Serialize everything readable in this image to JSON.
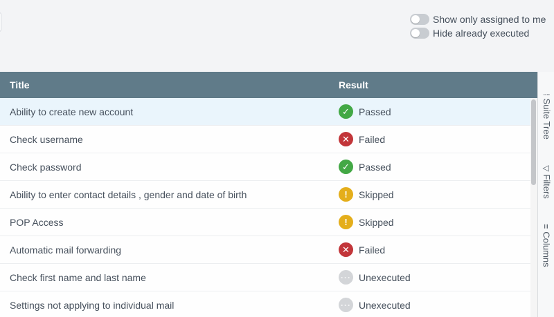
{
  "toggles": [
    {
      "label": "Show only assigned to me",
      "on": false
    },
    {
      "label": "Hide already executed",
      "on": false
    }
  ],
  "grid": {
    "columns": {
      "title": "Title",
      "result": "Result"
    },
    "rows": [
      {
        "title": "Ability to create new account",
        "result": "Passed",
        "status": "passed",
        "icon": "✓"
      },
      {
        "title": "Check username",
        "result": "Failed",
        "status": "failed",
        "icon": "✕"
      },
      {
        "title": "Check password",
        "result": "Passed",
        "status": "passed",
        "icon": "✓"
      },
      {
        "title": "Ability to enter contact details , gender and date of birth",
        "result": "Skipped",
        "status": "skipped",
        "icon": "!"
      },
      {
        "title": "POP Access",
        "result": "Skipped",
        "status": "skipped",
        "icon": "!"
      },
      {
        "title": "Automatic mail forwarding",
        "result": "Failed",
        "status": "failed",
        "icon": "✕"
      },
      {
        "title": "Check first name and last name",
        "result": "Unexecuted",
        "status": "unexecuted",
        "icon": "···"
      },
      {
        "title": "Settings not applying to individual mail",
        "result": "Unexecuted",
        "status": "unexecuted",
        "icon": "···"
      }
    ]
  },
  "side_panel": {
    "tabs": [
      {
        "label": "Suite Tree",
        "icon": "suite-tree-icon"
      },
      {
        "label": "Filters",
        "icon": "filter-icon"
      },
      {
        "label": "Columns",
        "icon": "columns-icon"
      }
    ]
  },
  "colors": {
    "header_bg": "#607b89",
    "passed": "#43a845",
    "failed": "#c2363a",
    "skipped": "#e4ae1b",
    "unexecuted": "#d3d5d8",
    "selected_row": "#eaf5fc"
  }
}
